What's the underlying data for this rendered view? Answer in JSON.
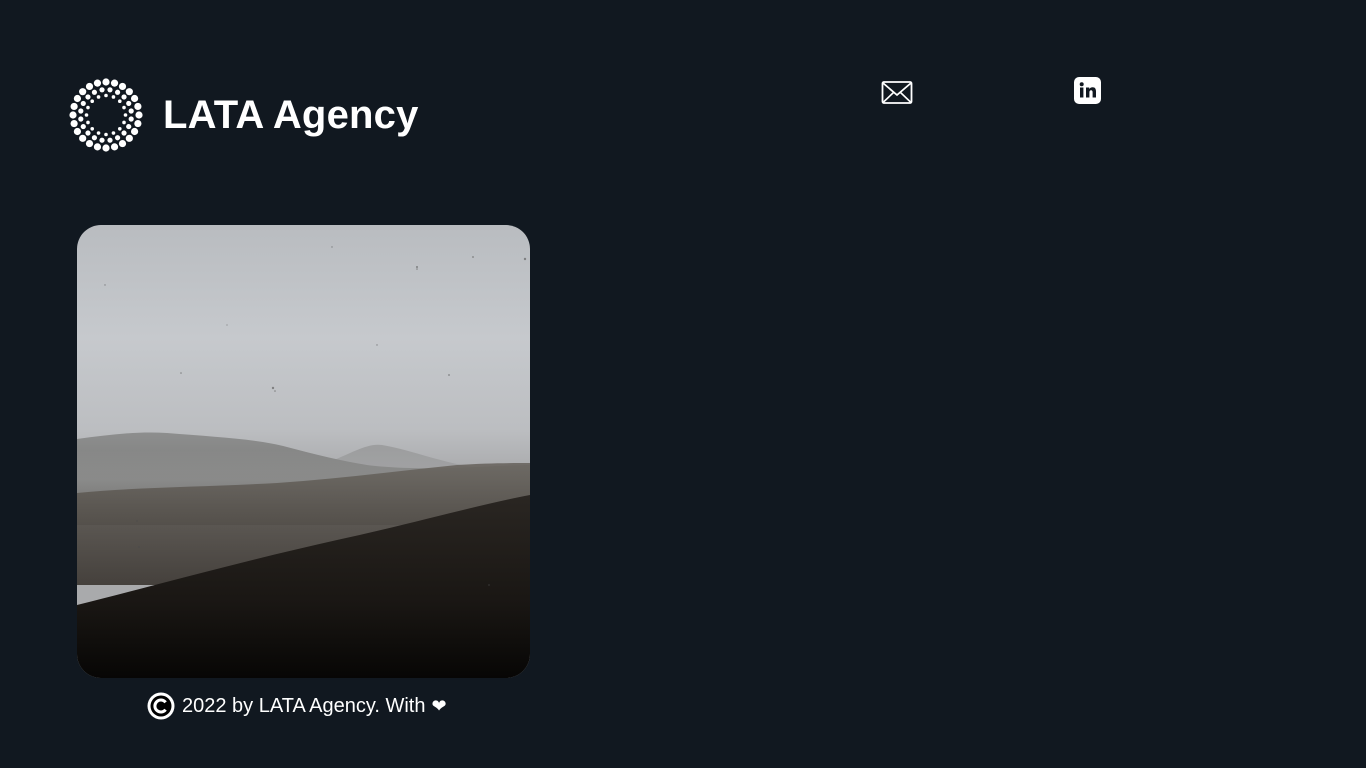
{
  "header": {
    "brand_name": "LATA Agency",
    "logo_icon": "dotted-sunburst-logo-icon"
  },
  "social": {
    "email_icon": "envelope-icon",
    "linkedin_icon": "linkedin-icon"
  },
  "hero": {
    "image_subject": "misty-hills-landscape"
  },
  "footer": {
    "text": "2022 by LATA Agency. With",
    "copyright_icon": "copyright-icon",
    "heart": "❤"
  },
  "colors": {
    "background": "#111820",
    "text": "#ffffff"
  }
}
